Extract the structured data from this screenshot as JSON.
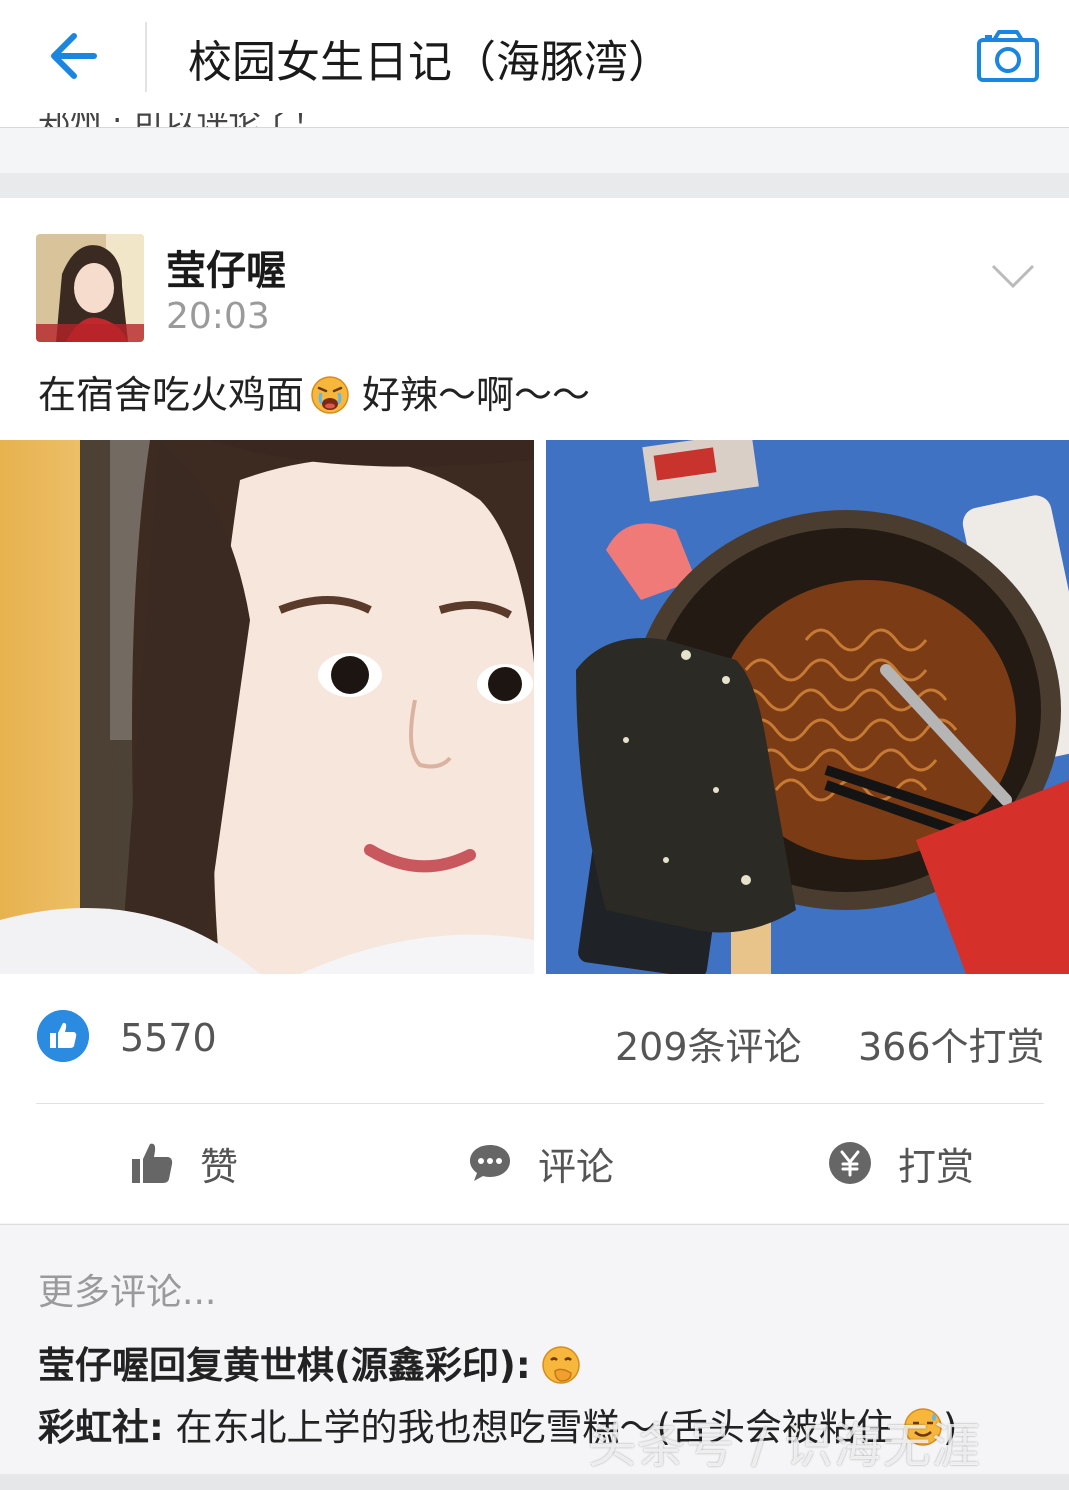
{
  "header": {
    "title": "校园女生日记（海豚湾）",
    "back_icon": "back-arrow-icon",
    "camera_icon": "camera-icon",
    "accent_color": "#1a86e0"
  },
  "previous_post_tail": "郑州 · 可以评论了！",
  "post": {
    "author": "莹仔喔",
    "time": "20:03",
    "text_part1": "在宿舍吃火鸡面",
    "text_part2": "好辣～啊～～",
    "emoji_icon": "crying-face-emoji",
    "photos": [
      {
        "name": "selfie-photo"
      },
      {
        "name": "noodles-and-ice-cream-photo"
      }
    ]
  },
  "stats": {
    "likes": "5570",
    "comments": "209条评论",
    "tips": "366个打赏"
  },
  "actions": {
    "like_label": "赞",
    "comment_label": "评论",
    "tip_label": "打赏"
  },
  "comments": {
    "more_label": "更多评论...",
    "items": [
      {
        "author": "莹仔喔回复黄世棋(源鑫彩印)",
        "sep": ":",
        "text": "",
        "emoji": "hand-over-mouth-emoji"
      },
      {
        "author": "彩虹社",
        "sep": ":",
        "text": " 在东北上学的我也想吃雪糕～(舌头会被粘住",
        "tail": ")",
        "emoji": "sweat-smile-emoji"
      }
    ]
  },
  "watermark": "头条号 / 识海无涯"
}
